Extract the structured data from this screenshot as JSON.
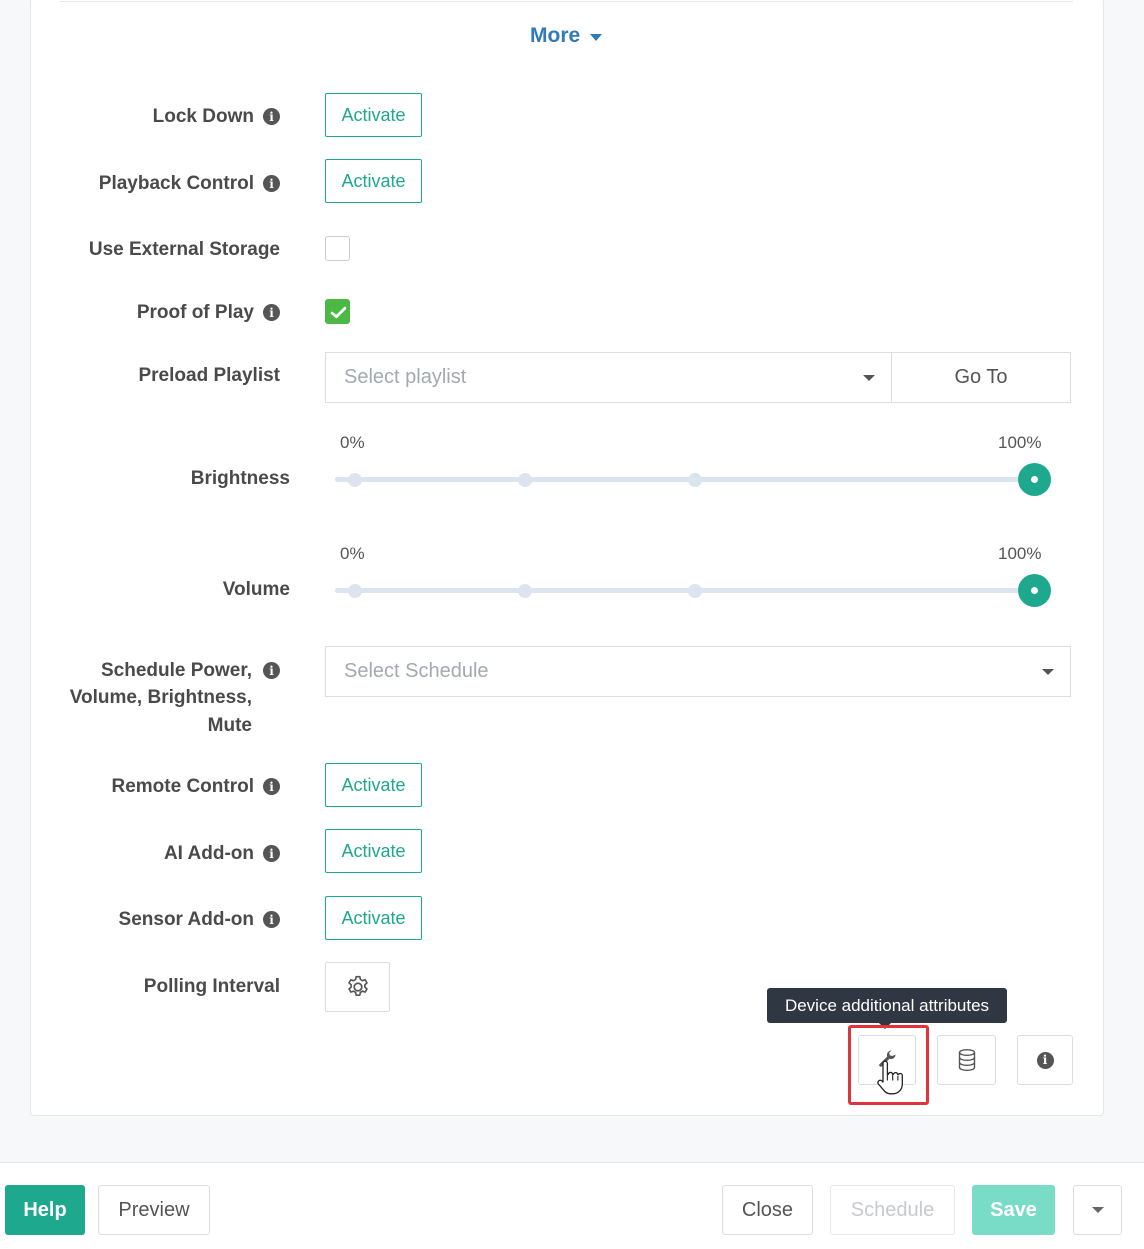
{
  "more": {
    "label": "More"
  },
  "settings": {
    "lock_down": {
      "label": "Lock Down",
      "button": "Activate"
    },
    "playback_control": {
      "label": "Playback Control",
      "button": "Activate"
    },
    "use_external_storage": {
      "label": "Use External Storage",
      "checked": false
    },
    "proof_of_play": {
      "label": "Proof of Play",
      "checked": true
    },
    "preload_playlist": {
      "label": "Preload Playlist",
      "placeholder": "Select playlist",
      "goto": "Go To"
    },
    "brightness": {
      "label": "Brightness",
      "min_label": "0%",
      "max_label": "100%",
      "value": 100
    },
    "volume": {
      "label": "Volume",
      "min_label": "0%",
      "max_label": "100%",
      "value": 100
    },
    "schedule": {
      "label_line1": "Schedule Power,",
      "label_line2": "Volume, Brightness,",
      "label_line3": "Mute",
      "placeholder": "Select Schedule"
    },
    "remote_control": {
      "label": "Remote Control",
      "button": "Activate"
    },
    "ai_addon": {
      "label": "AI Add-on",
      "button": "Activate"
    },
    "sensor_addon": {
      "label": "Sensor Add-on",
      "button": "Activate"
    },
    "polling_interval": {
      "label": "Polling Interval"
    }
  },
  "tooltip": {
    "text": "Device additional attributes"
  },
  "info_glyph": "i",
  "footer": {
    "help": "Help",
    "preview": "Preview",
    "close": "Close",
    "schedule": "Schedule",
    "save": "Save"
  },
  "colors": {
    "accent": "#1ea88e",
    "link": "#2f7ab7",
    "checked": "#4cb944",
    "highlight": "#e0333b",
    "tooltip_bg": "#2f3842"
  },
  "icons": {
    "wrench": "wrench-icon",
    "database": "database-icon",
    "info": "info-icon",
    "gear": "gear-icon",
    "pointer": "hand-pointer-icon"
  }
}
